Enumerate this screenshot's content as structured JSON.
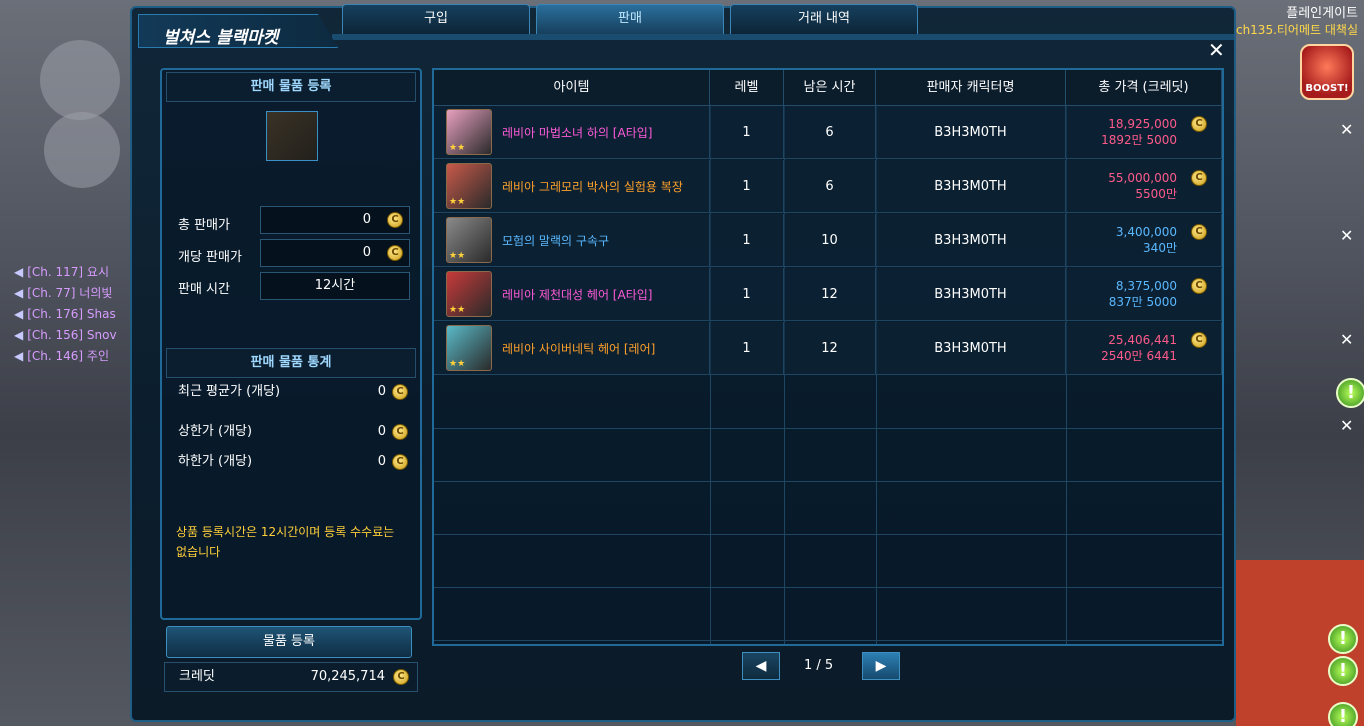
{
  "hud": {
    "server_name": "플레인게이트",
    "channel_info": "ch135.티어메트 대책실",
    "boost_label": "BOOST!",
    "chat_lines": [
      {
        "channel": "[Ch. 117] 요시"
      },
      {
        "channel": "[Ch. 77] 너의빛"
      },
      {
        "channel": "[Ch. 176] Shas"
      },
      {
        "channel": "[Ch. 156] Snov"
      },
      {
        "channel": "[Ch. 146] 주인"
      }
    ]
  },
  "window": {
    "title": "벌쳐스 블랙마켓",
    "close_label": "✕",
    "tabs": [
      "구입",
      "판매",
      "거래 내역"
    ],
    "active_tab": "판매"
  },
  "register": {
    "header": "판매 물품 등록",
    "total_price_label": "총 판매가",
    "total_price_value": "0",
    "unit_price_label": "개당 판매가",
    "unit_price_value": "0",
    "sale_time_label": "판매 시간",
    "sale_time_value": "12시간"
  },
  "stats": {
    "header": "판매 물품 통계",
    "recent_avg_label": "최근 평균가 (개당)",
    "recent_avg_value": "0",
    "upper_label": "상한가 (개당)",
    "upper_value": "0",
    "lower_label": "하한가 (개당)",
    "lower_value": "0"
  },
  "notice": "상품 등록시간은 12시간이며 등록 수수료는 없습니다",
  "register_button": "물품 등록",
  "credit": {
    "label": "크레딧",
    "value": "70,245,714"
  },
  "coin_glyph": "C",
  "table": {
    "headers": [
      "아이템",
      "레벨",
      "남은 시간",
      "판매자 캐릭터명",
      "총 가격 (크레딧)"
    ],
    "rows": [
      {
        "name": "레비아 마법소녀 하의 [A타입]",
        "name_color": "#ff5ad8",
        "level": "1",
        "time": "6",
        "seller": "B3H3M0TH",
        "price": "18,925,000",
        "price_kr": "1892만 5000",
        "price_color": "#ff5a8a",
        "thumb_color": "#e8a0c0"
      },
      {
        "name": "레비아 그레모리 박사의 실험용 복장",
        "name_color": "#ffa02a",
        "level": "1",
        "time": "6",
        "seller": "B3H3M0TH",
        "price": "55,000,000",
        "price_kr": "5500만",
        "price_color": "#ff5a8a",
        "thumb_color": "#c85a4a"
      },
      {
        "name": "모험의 말랙의 구속구",
        "name_color": "#5ab8ff",
        "level": "1",
        "time": "10",
        "seller": "B3H3M0TH",
        "price": "3,400,000",
        "price_kr": "340만",
        "price_color": "#5ab8ff",
        "thumb_color": "#8a8a8a"
      },
      {
        "name": "레비아 제천대성 헤어 [A타입]",
        "name_color": "#ff5ad8",
        "level": "1",
        "time": "12",
        "seller": "B3H3M0TH",
        "price": "8,375,000",
        "price_kr": "837만 5000",
        "price_color": "#5ab8ff",
        "thumb_color": "#c83a3a"
      },
      {
        "name": "레비아 사이버네틱 헤어 [레어]",
        "name_color": "#ffa02a",
        "level": "1",
        "time": "12",
        "seller": "B3H3M0TH",
        "price": "25,406,441",
        "price_kr": "2540만 6441",
        "price_color": "#ff5a8a",
        "thumb_color": "#5abac8"
      }
    ]
  },
  "pager": {
    "prev": "◀",
    "next": "▶",
    "text": "1 / 5"
  }
}
